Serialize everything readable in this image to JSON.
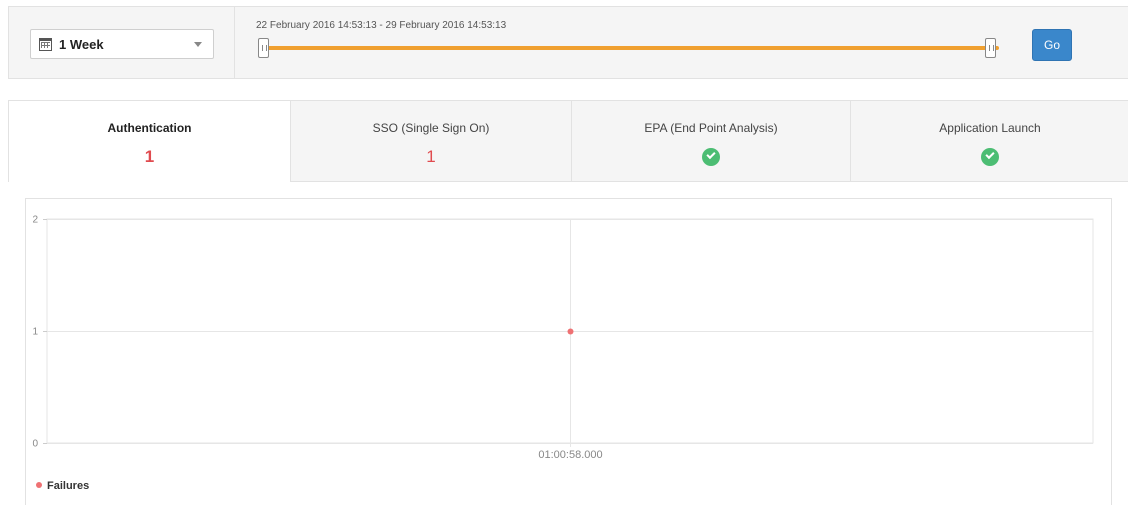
{
  "filter": {
    "period": "1 Week",
    "range_text": "22 February 2016 14:53:13 - 29 February 2016 14:53:13",
    "go_label": "Go"
  },
  "tabs": [
    {
      "label": "Authentication",
      "count": "1",
      "status": "failure",
      "active": true
    },
    {
      "label": "SSO (Single Sign On)",
      "count": "1",
      "status": "failure",
      "active": false
    },
    {
      "label": "EPA (End Point Analysis)",
      "count": "",
      "status": "success",
      "active": false
    },
    {
      "label": "Application Launch",
      "count": "",
      "status": "success",
      "active": false
    }
  ],
  "colors": {
    "accent_blue": "#3a87cb",
    "slider_orange": "#f0a030",
    "failure_red": "#e04b4f",
    "success_green": "#4cbd73",
    "series_pink": "#ef7173"
  },
  "chart_data": {
    "type": "scatter",
    "title": "",
    "xlabel": "",
    "ylabel": "",
    "y_ticks": [
      "0",
      "1",
      "2"
    ],
    "ylim": [
      0,
      2
    ],
    "x_ticks": [
      "01:00:58.000"
    ],
    "grid": true,
    "legend": "bottom-left",
    "series": [
      {
        "name": "Failures",
        "color": "#ef7173",
        "points": [
          {
            "x": "01:00:58.000",
            "y": 1
          }
        ]
      }
    ]
  }
}
